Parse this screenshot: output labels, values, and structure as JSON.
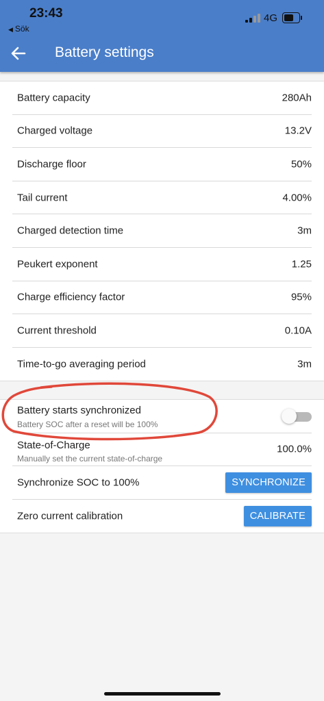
{
  "status_bar": {
    "time": "23:43",
    "back_app": "Sök",
    "network": "4G"
  },
  "header": {
    "title": "Battery settings"
  },
  "settings": [
    {
      "label": "Battery capacity",
      "value": "280Ah"
    },
    {
      "label": "Charged voltage",
      "value": "13.2V"
    },
    {
      "label": "Discharge floor",
      "value": "50%"
    },
    {
      "label": "Tail current",
      "value": "4.00%"
    },
    {
      "label": "Charged detection time",
      "value": "3m"
    },
    {
      "label": "Peukert exponent",
      "value": "1.25"
    },
    {
      "label": "Charge efficiency factor",
      "value": "95%"
    },
    {
      "label": "Current threshold",
      "value": "0.10A"
    },
    {
      "label": "Time-to-go averaging period",
      "value": "3m"
    }
  ],
  "sync": {
    "label": "Battery starts synchronized",
    "description": "Battery SOC after a reset will be 100%",
    "enabled": false
  },
  "soc": {
    "label": "State-of-Charge",
    "description": "Manually set the current state-of-charge",
    "value": "100.0%"
  },
  "synchronize": {
    "label": "Synchronize SOC to 100%",
    "button": "SYNCHRONIZE"
  },
  "calibrate": {
    "label": "Zero current calibration",
    "button": "CALIBRATE"
  },
  "colors": {
    "header": "#4a7ec9",
    "button": "#3f8fe0",
    "annotation": "#e0483a"
  }
}
